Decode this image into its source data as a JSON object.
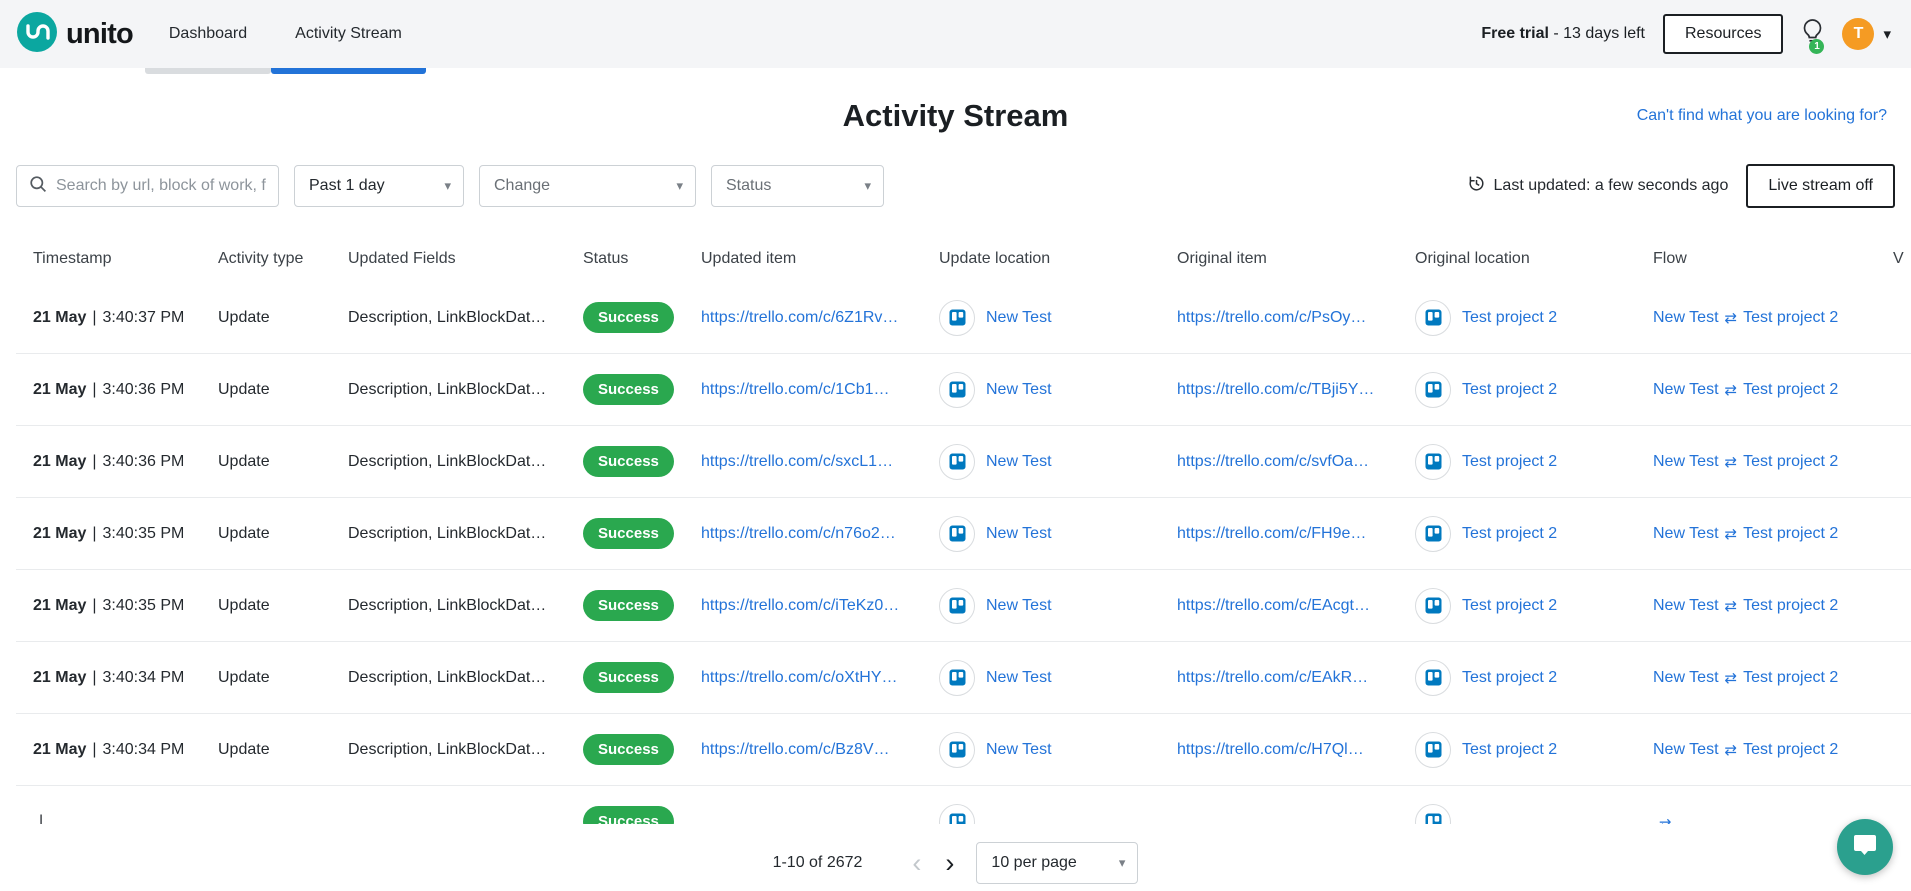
{
  "brand": {
    "name": "unito",
    "logo_color": "#0ba7a0"
  },
  "nav": {
    "tabs": [
      {
        "label": "Dashboard",
        "active": false
      },
      {
        "label": "Activity Stream",
        "active": true
      }
    ]
  },
  "topbar": {
    "trial_bold": "Free trial",
    "trial_rest": "- 13 days left",
    "resources_label": "Resources",
    "notification_count": "1",
    "avatar_initial": "T"
  },
  "page": {
    "title": "Activity Stream",
    "help_link": "Can't find what you are looking for?"
  },
  "filters": {
    "search_placeholder": "Search by url, block of work, f",
    "date_range": "Past 1 day",
    "change": "Change",
    "status": "Status",
    "last_updated": "Last updated: a few seconds ago",
    "live_stream_label": "Live stream off"
  },
  "icons": {
    "caret_down": "▾",
    "chevron_left": "‹",
    "chevron_right": "›",
    "sync_arrows": "⇄"
  },
  "table": {
    "timestamp_separator": "|",
    "headers": [
      "Timestamp",
      "Activity type",
      "Updated Fields",
      "Status",
      "Updated item",
      "Update location",
      "Original item",
      "Original location",
      "Flow",
      "V"
    ],
    "rows": [
      {
        "date": "21 May",
        "time": "3:40:37 PM",
        "activity_type": "Update",
        "updated_fields": "Description, LinkBlockDat…",
        "status": "Success",
        "updated_item": "https://trello.com/c/6Z1Rv…",
        "update_location": "New Test",
        "original_item": "https://trello.com/c/PsOy…",
        "original_location": "Test project 2",
        "flow_from": "New Test",
        "flow_to": "Test project 2"
      },
      {
        "date": "21 May",
        "time": "3:40:36 PM",
        "activity_type": "Update",
        "updated_fields": "Description, LinkBlockDat…",
        "status": "Success",
        "updated_item": "https://trello.com/c/1Cb1…",
        "update_location": "New Test",
        "original_item": "https://trello.com/c/TBji5Y…",
        "original_location": "Test project 2",
        "flow_from": "New Test",
        "flow_to": "Test project 2"
      },
      {
        "date": "21 May",
        "time": "3:40:36 PM",
        "activity_type": "Update",
        "updated_fields": "Description, LinkBlockDat…",
        "status": "Success",
        "updated_item": "https://trello.com/c/sxcL1…",
        "update_location": "New Test",
        "original_item": "https://trello.com/c/svfOa…",
        "original_location": "Test project 2",
        "flow_from": "New Test",
        "flow_to": "Test project 2"
      },
      {
        "date": "21 May",
        "time": "3:40:35 PM",
        "activity_type": "Update",
        "updated_fields": "Description, LinkBlockDat…",
        "status": "Success",
        "updated_item": "https://trello.com/c/n76o2…",
        "update_location": "New Test",
        "original_item": "https://trello.com/c/FH9e…",
        "original_location": "Test project 2",
        "flow_from": "New Test",
        "flow_to": "Test project 2"
      },
      {
        "date": "21 May",
        "time": "3:40:35 PM",
        "activity_type": "Update",
        "updated_fields": "Description, LinkBlockDat…",
        "status": "Success",
        "updated_item": "https://trello.com/c/iTeKz0…",
        "update_location": "New Test",
        "original_item": "https://trello.com/c/EAcgt…",
        "original_location": "Test project 2",
        "flow_from": "New Test",
        "flow_to": "Test project 2"
      },
      {
        "date": "21 May",
        "time": "3:40:34 PM",
        "activity_type": "Update",
        "updated_fields": "Description, LinkBlockDat…",
        "status": "Success",
        "updated_item": "https://trello.com/c/oXtHY…",
        "update_location": "New Test",
        "original_item": "https://trello.com/c/EAkR…",
        "original_location": "Test project 2",
        "flow_from": "New Test",
        "flow_to": "Test project 2"
      },
      {
        "date": "21 May",
        "time": "3:40:34 PM",
        "activity_type": "Update",
        "updated_fields": "Description, LinkBlockDat…",
        "status": "Success",
        "updated_item": "https://trello.com/c/Bz8V…",
        "update_location": "New Test",
        "original_item": "https://trello.com/c/H7Ql…",
        "original_location": "Test project 2",
        "flow_from": "New Test",
        "flow_to": "Test project 2"
      },
      {
        "date": "",
        "time": "",
        "activity_type": "",
        "updated_fields": "",
        "status": "Success",
        "updated_item": "",
        "update_location": "",
        "original_item": "",
        "original_location": "",
        "flow_from": "",
        "flow_to": ""
      }
    ]
  },
  "pagination": {
    "range_label": "1-10 of 2672",
    "per_page": "10 per page"
  }
}
